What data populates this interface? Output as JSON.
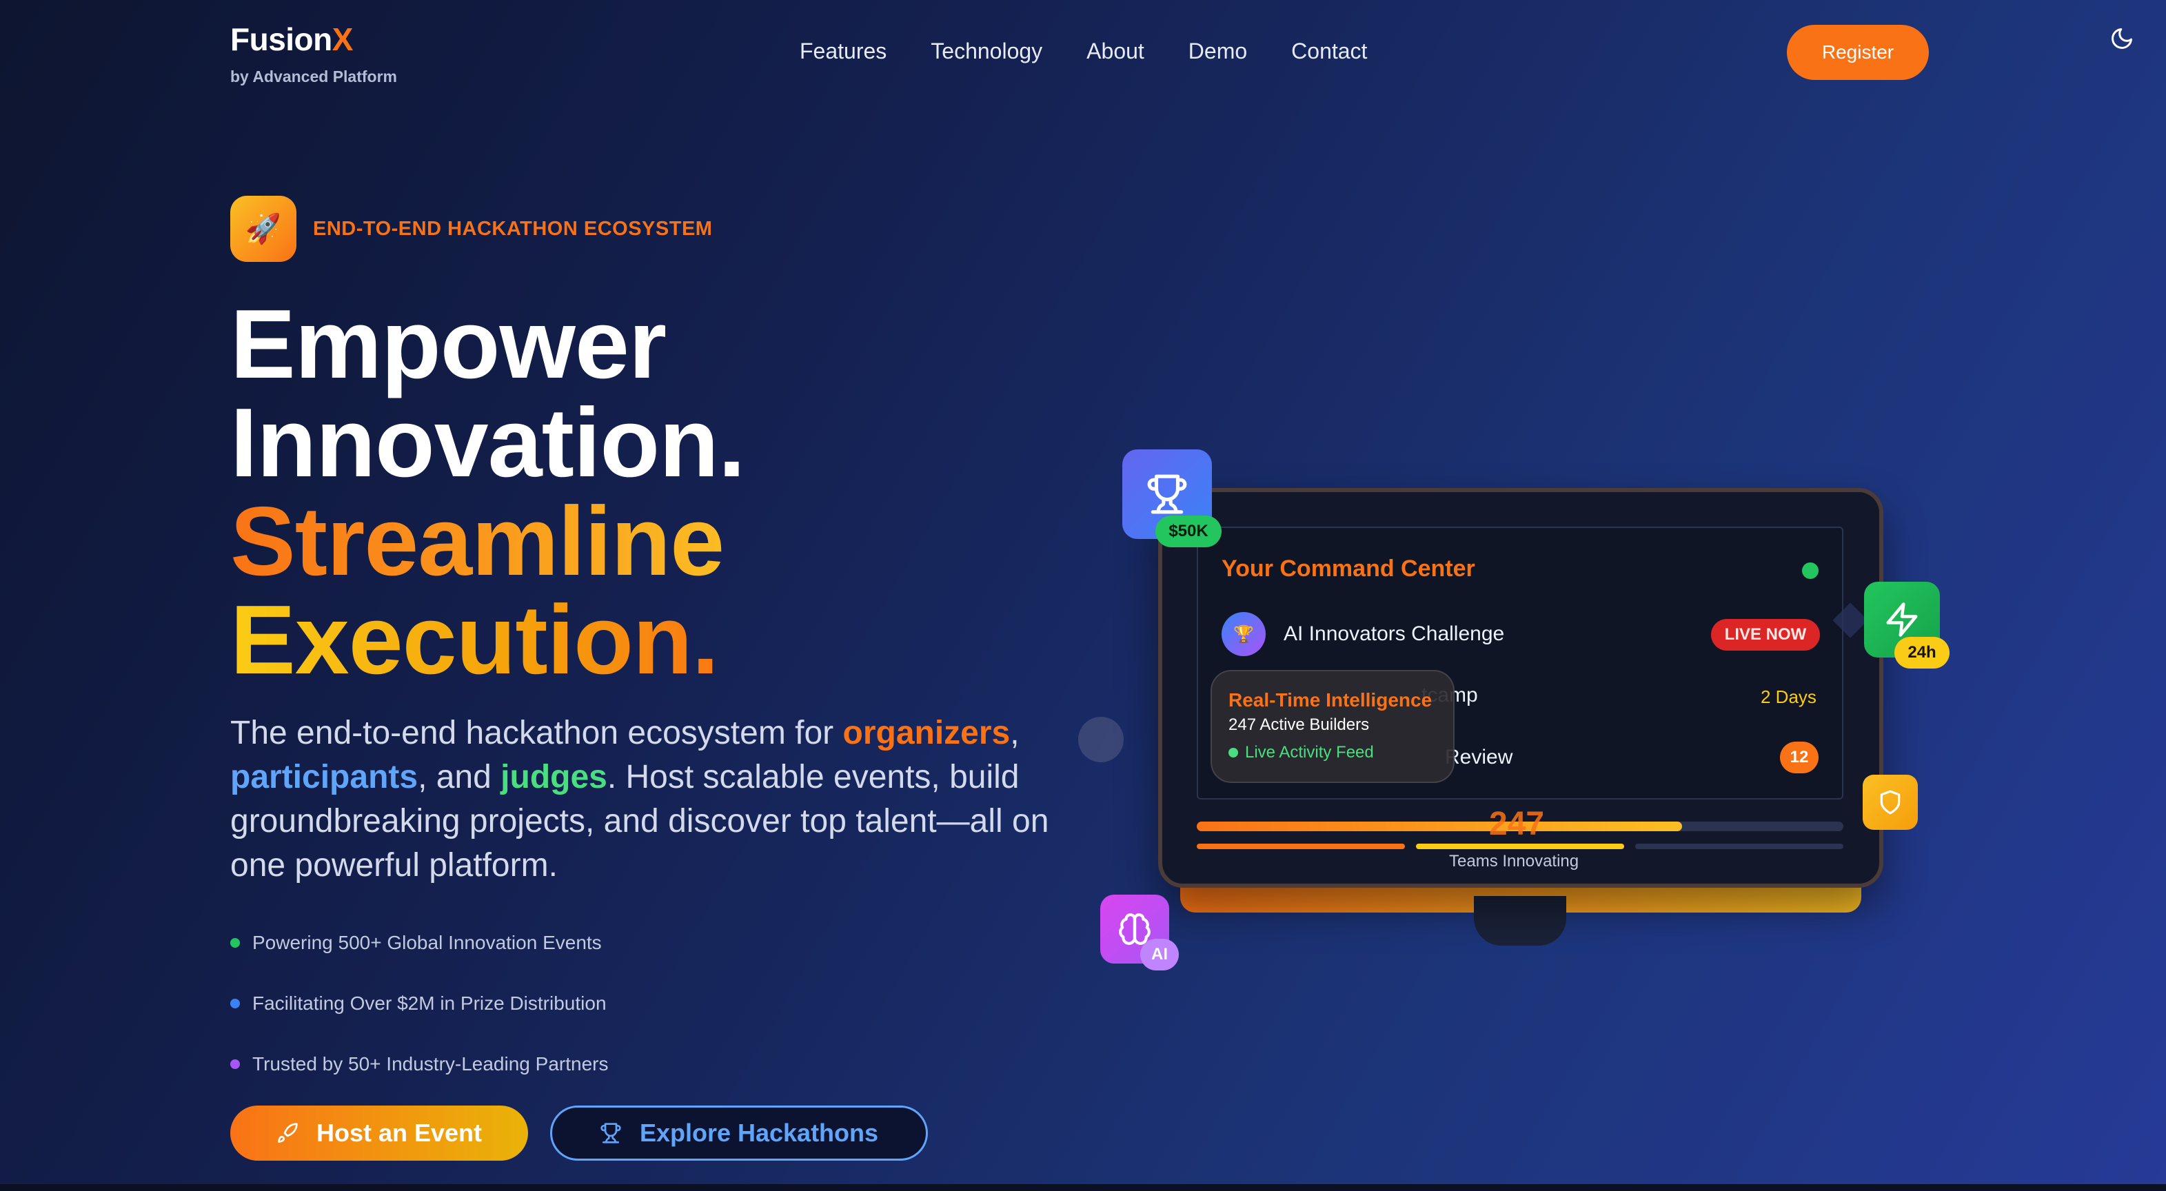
{
  "brand": {
    "name": "Fusion",
    "name_accent": "X",
    "tagline": "by Advanced Platform"
  },
  "nav": {
    "items": [
      "Features",
      "Technology",
      "About",
      "Demo",
      "Contact"
    ],
    "register_label": "Register"
  },
  "hero": {
    "eyebrow": "END-TO-END HACKATHON ECOSYSTEM",
    "eyebrow_icon": "rocket-icon",
    "headline": [
      "Empower",
      "Innovation.",
      "Streamline",
      "Execution."
    ],
    "lead_prefix": "The end-to-end hackathon ecosystem for ",
    "lead_organizers": "organizers",
    "lead_sep1": ", ",
    "lead_participants": "participants",
    "lead_sep2": ", and ",
    "lead_judges": "judges",
    "lead_suffix": ". Host scalable events, build groundbreaking projects, and discover top talent—all on one powerful platform.",
    "stats": [
      {
        "text": "Powering 500+ Global Innovation Events",
        "color": "#22c55e"
      },
      {
        "text": "Facilitating Over $2M in Prize Distribution",
        "color": "#3b82f6"
      },
      {
        "text": "Trusted by 50+ Industry-Leading Partners",
        "color": "#a855f7"
      }
    ],
    "cta_primary": "Host an Event",
    "cta_secondary": "Explore Hackathons"
  },
  "mockup": {
    "title": "Your Command Center",
    "rows": [
      {
        "label": "AI Innovators Challenge",
        "badge": "LIVE NOW"
      },
      {
        "label": "tcamp",
        "badge": "2 Days"
      },
      {
        "label": "Review",
        "badge": "12"
      }
    ],
    "popover": {
      "title": "Real-Time Intelligence",
      "subtitle": "247 Active Builders",
      "live": "Live Activity Feed"
    },
    "teams_count": "247",
    "teams_label": "Teams Innovating",
    "progress": 0.75,
    "badges": {
      "prize": "$50K",
      "duration": "24h",
      "ai": "AI"
    }
  },
  "colors": {
    "accent": "#f97316",
    "gold": "#facc15",
    "blue": "#60a5fa",
    "green": "#4ade80"
  }
}
